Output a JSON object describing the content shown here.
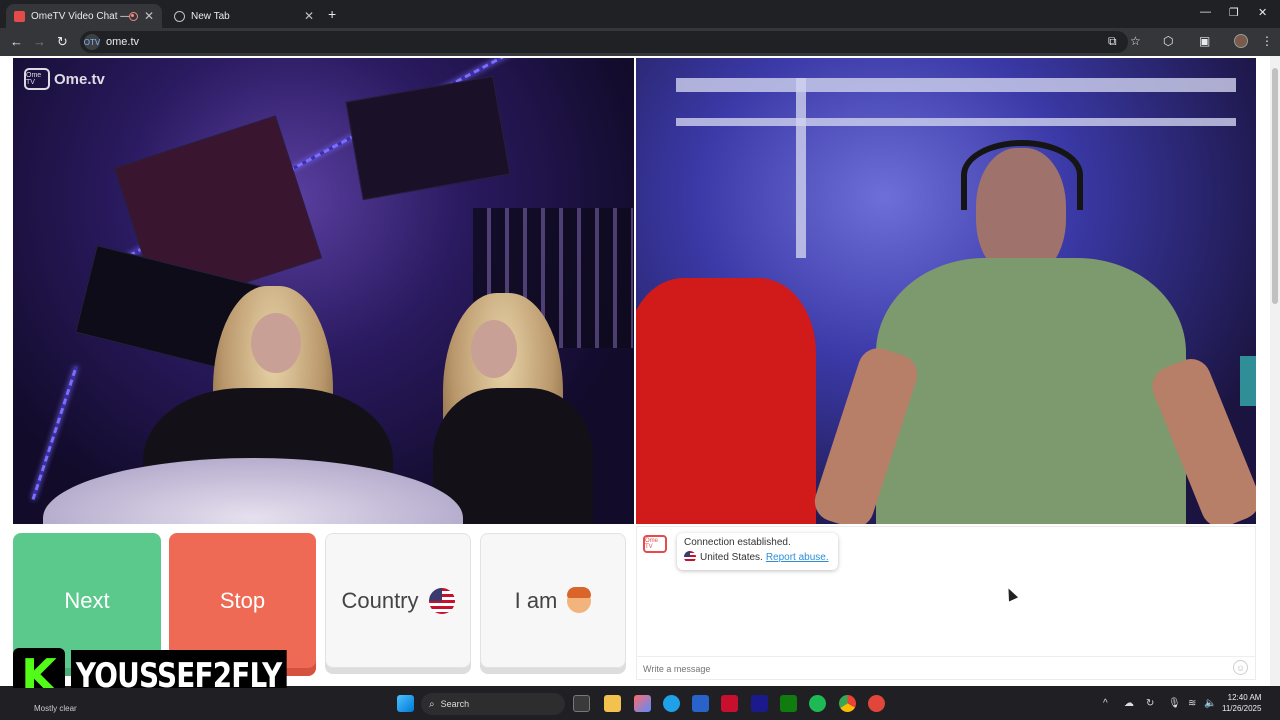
{
  "browser": {
    "tabs": [
      {
        "title": "OmeTV Video Chat — Ome",
        "active": true
      },
      {
        "title": "New Tab",
        "active": false
      }
    ],
    "url": "ome.tv",
    "site_icon_text": "OTV",
    "icons": [
      "back-icon",
      "forward-icon",
      "reload-icon",
      "install-icon",
      "star-icon",
      "extensions-icon",
      "sidepanel-icon",
      "profile-icon",
      "menu-icon"
    ]
  },
  "video": {
    "logo_text": "Ome.tv",
    "logo_icon_text": "Ome TV"
  },
  "controls": {
    "next_label": "Next",
    "stop_label": "Stop",
    "country_label": "Country",
    "iam_label": "I am"
  },
  "chat": {
    "logo_text": "Ome TV",
    "status": "Connection established.",
    "country": "United States.",
    "report": "Report abuse.",
    "input_placeholder": "Write a message"
  },
  "overlay": {
    "badge_letter": "K",
    "handle": "YOUSSEF2FLY"
  },
  "taskbar": {
    "weather": "Mostly clear",
    "search_label": "Search",
    "time": "12:40 AM",
    "date": "11/26/2025"
  },
  "colors": {
    "next": "#5cc98c",
    "stop": "#ee6a55",
    "accent_link": "#2a8ed8",
    "kick_green": "#53fc18"
  }
}
